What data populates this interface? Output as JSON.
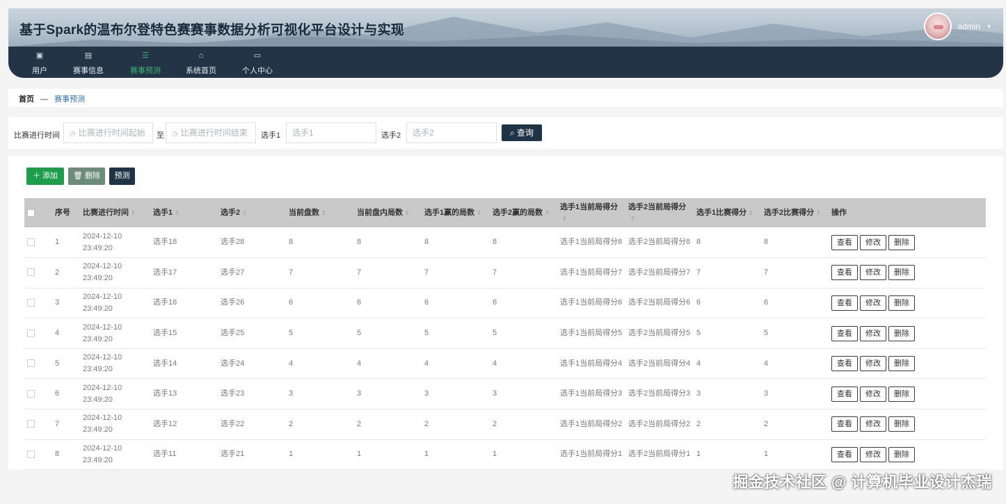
{
  "header": {
    "title": "基于Spark的温布尔登特色赛赛事数据分析可视化平台设计与实现",
    "user": {
      "name": "admin"
    }
  },
  "nav": [
    {
      "label": "用户",
      "icon": "document-icon"
    },
    {
      "label": "赛事信息",
      "icon": "checklist-icon"
    },
    {
      "label": "赛事预测",
      "icon": "list-icon",
      "active": true
    },
    {
      "label": "系统首页",
      "icon": "home-icon"
    },
    {
      "label": "个人中心",
      "icon": "card-icon"
    }
  ],
  "breadcrumb": {
    "home": "首页",
    "separator": "—",
    "current": "赛事预测"
  },
  "search": {
    "time_label": "比赛进行时间",
    "time_start_placeholder": "比赛进行时间起始",
    "to": "至",
    "time_end_placeholder": "比赛进行时间结束",
    "p1_label": "选手1",
    "p1_placeholder": "选手1",
    "p2_label": "选手2",
    "p2_placeholder": "选手2",
    "query": "查询"
  },
  "toolbar": {
    "add": "添加",
    "delete": "删除",
    "predict": "预测"
  },
  "table": {
    "columns": [
      "序号",
      "比赛进行时间",
      "选手1",
      "选手2",
      "当前盘数",
      "当前盘内局数",
      "选手1赢的局数",
      "选手2赢的局数",
      "选手1当前局得分",
      "选手2当前局得分",
      "选手1比赛得分",
      "选手2比赛得分",
      "操作"
    ],
    "actions": {
      "view": "查看",
      "edit": "修改",
      "delete": "删除"
    },
    "rows": [
      {
        "idx": "1",
        "time": "2024-12-10 23:49:20",
        "p1": "选手18",
        "p2": "选手28",
        "set": "8",
        "game": "8",
        "p1_won": "8",
        "p2_won": "8",
        "p1_pt": "选手1当前局得分8",
        "p2_pt": "选手2当前局得分8",
        "p1_score": "8",
        "p2_score": "8"
      },
      {
        "idx": "2",
        "time": "2024-12-10 23:49:20",
        "p1": "选手17",
        "p2": "选手27",
        "set": "7",
        "game": "7",
        "p1_won": "7",
        "p2_won": "7",
        "p1_pt": "选手1当前局得分7",
        "p2_pt": "选手2当前局得分7",
        "p1_score": "7",
        "p2_score": "7"
      },
      {
        "idx": "3",
        "time": "2024-12-10 23:49:20",
        "p1": "选手16",
        "p2": "选手26",
        "set": "6",
        "game": "6",
        "p1_won": "6",
        "p2_won": "6",
        "p1_pt": "选手1当前局得分6",
        "p2_pt": "选手2当前局得分6",
        "p1_score": "6",
        "p2_score": "6"
      },
      {
        "idx": "4",
        "time": "2024-12-10 23:49:20",
        "p1": "选手15",
        "p2": "选手25",
        "set": "5",
        "game": "5",
        "p1_won": "5",
        "p2_won": "5",
        "p1_pt": "选手1当前局得分5",
        "p2_pt": "选手2当前局得分5",
        "p1_score": "5",
        "p2_score": "5"
      },
      {
        "idx": "5",
        "time": "2024-12-10 23:49:20",
        "p1": "选手14",
        "p2": "选手24",
        "set": "4",
        "game": "4",
        "p1_won": "4",
        "p2_won": "4",
        "p1_pt": "选手1当前局得分4",
        "p2_pt": "选手2当前局得分4",
        "p1_score": "4",
        "p2_score": "4"
      },
      {
        "idx": "6",
        "time": "2024-12-10 23:49:20",
        "p1": "选手13",
        "p2": "选手23",
        "set": "3",
        "game": "3",
        "p1_won": "3",
        "p2_won": "3",
        "p1_pt": "选手1当前局得分3",
        "p2_pt": "选手2当前局得分3",
        "p1_score": "3",
        "p2_score": "3"
      },
      {
        "idx": "7",
        "time": "2024-12-10 23:49:20",
        "p1": "选手12",
        "p2": "选手22",
        "set": "2",
        "game": "2",
        "p1_won": "2",
        "p2_won": "2",
        "p1_pt": "选手1当前局得分2",
        "p2_pt": "选手2当前局得分2",
        "p1_score": "2",
        "p2_score": "2"
      },
      {
        "idx": "8",
        "time": "2024-12-10 23:49:20",
        "p1": "选手11",
        "p2": "选手21",
        "set": "1",
        "game": "1",
        "p1_won": "1",
        "p2_won": "1",
        "p1_pt": "选手1当前局得分1",
        "p2_pt": "选手2当前局得分1",
        "p1_score": "1",
        "p2_score": "1"
      }
    ]
  },
  "watermark": "掘金技术社区 @ 计算机毕业设计杰瑞",
  "colors": {
    "nav_bg": "#233446",
    "active": "#3cb371",
    "add": "#1e9e4c",
    "delete": "#6b8c78",
    "dark_button": "#1f3346"
  }
}
